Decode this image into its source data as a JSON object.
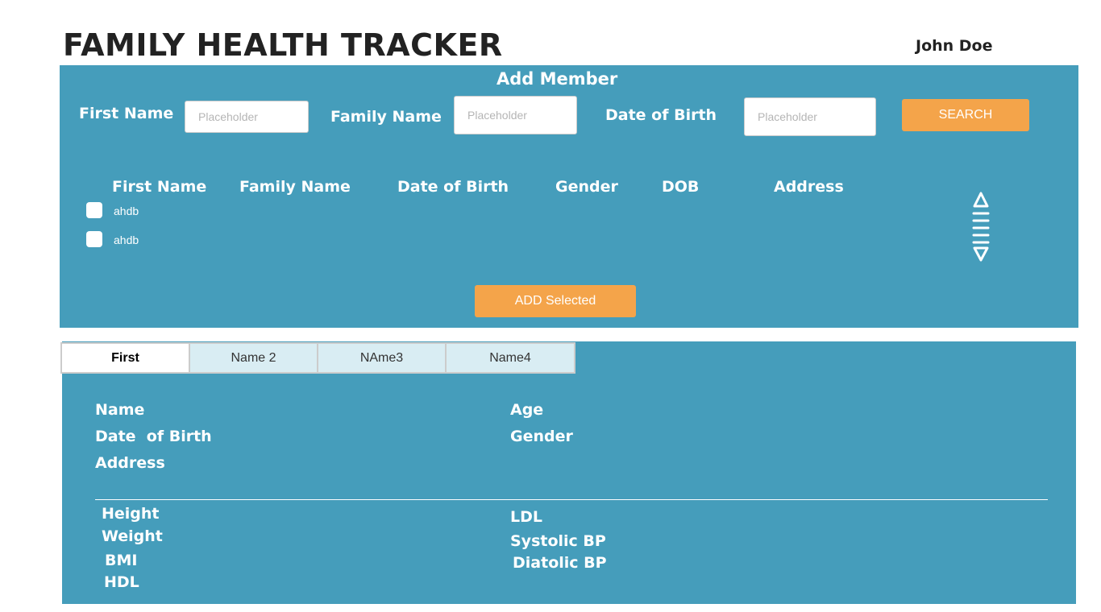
{
  "header": {
    "title": "FAMILY HEALTH TRACKER",
    "user_name": "John Doe"
  },
  "add_member": {
    "heading": "Add Member",
    "first_name_label": "First Name",
    "family_name_label": "Family Name",
    "dob_label": "Date of Birth",
    "first_name_placeholder": "Placeholder",
    "family_name_placeholder": "Placeholder",
    "dob_placeholder": "Placeholder",
    "search_label": "SEARCH",
    "columns": [
      "First Name",
      "Family Name",
      "Date of Birth",
      "Gender",
      "DOB",
      "Address"
    ],
    "rows": [
      {
        "first_name": "ahdb"
      },
      {
        "first_name": "ahdb"
      }
    ],
    "add_selected_label": "ADD Selected",
    "scroll_icon": "vertical-scroll-icon"
  },
  "member_tabs": [
    {
      "label": "First",
      "active": true
    },
    {
      "label": "Name 2",
      "active": false
    },
    {
      "label": "NAme3",
      "active": false
    },
    {
      "label": "Name4",
      "active": false
    }
  ],
  "member_details": {
    "name": "Name",
    "age": "Age",
    "date_of_birth": "Date  of Birth",
    "gender": "Gender",
    "address": "Address",
    "height": "Height",
    "weight": "Weight",
    "bmi": "BMI",
    "hdl": "HDL",
    "ldl": "LDL",
    "systolic_bp": "Systolic BP",
    "diastolic_bp": "Diatolic BP"
  },
  "colors": {
    "panel": "#459dbb",
    "accent": "#f4a44a",
    "tab_inactive": "#d9edf3"
  }
}
